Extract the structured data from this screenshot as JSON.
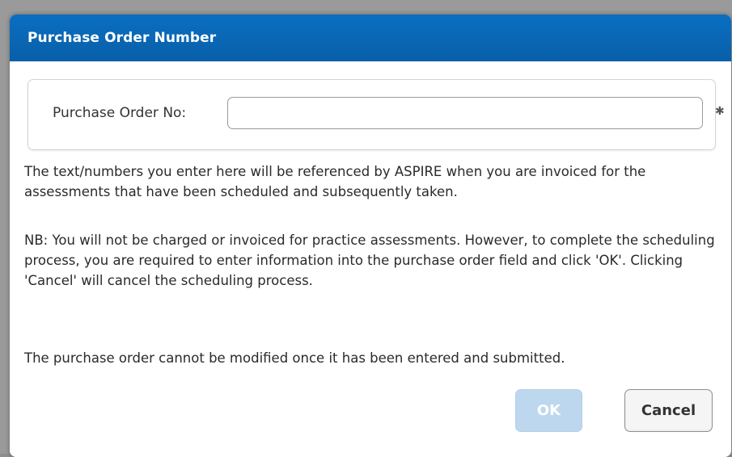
{
  "dialog": {
    "title": "Purchase Order Number",
    "field": {
      "label": "Purchase Order No:",
      "value": "",
      "placeholder": "",
      "required_marker": "✱"
    },
    "paragraphs": [
      "The text/numbers you enter here will be referenced by ASPIRE when you are invoiced for the assessments that have been scheduled and subsequently taken.",
      "NB: You will not be charged or invoiced for practice assessments. However, to complete the scheduling process, you are required to enter information into the purchase order field and click 'OK'. Clicking 'Cancel' will cancel the scheduling process.",
      "The purchase order cannot be modified once it has been entered and submitted."
    ],
    "buttons": {
      "ok_label": "OK",
      "cancel_label": "Cancel"
    }
  },
  "colors": {
    "titlebar": "#0a6fc2",
    "ok_disabled": "#bdd7ee"
  }
}
